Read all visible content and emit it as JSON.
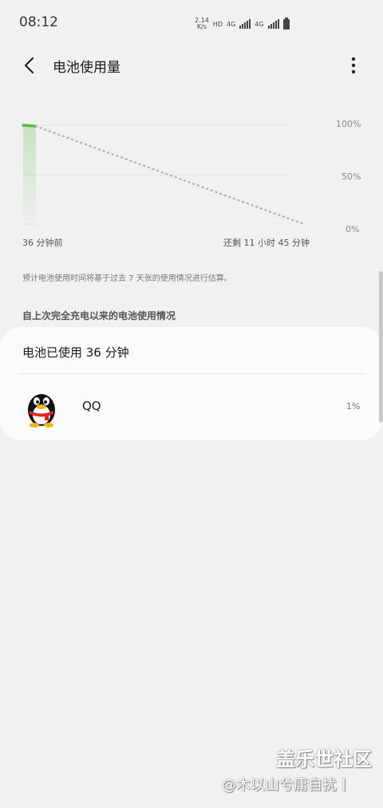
{
  "status_bar": {
    "time": "08:12",
    "net_speed_value": "2.14",
    "net_speed_unit": "K/s",
    "hd": "HD",
    "network_1": "4G",
    "network_2": "4G"
  },
  "header": {
    "title": "电池使用量"
  },
  "chart_data": {
    "type": "line",
    "y_ticks": [
      "100%",
      "50%",
      "0%"
    ],
    "ylim": [
      0,
      100
    ],
    "x_start_label": "36 分钟前",
    "x_end_label": "还剩 11 小时 45 分钟",
    "series": [
      {
        "values": [
          {
            "x": -36,
            "y": 100
          },
          {
            "x": 0,
            "y": 99
          }
        ]
      },
      {
        "values": [
          {
            "x": 0,
            "y": 99
          },
          {
            "x": 705,
            "y": 0
          }
        ]
      }
    ],
    "colors": {
      "actual": "#5bbd47",
      "projection": "#b5b5b5",
      "grid": "#e2e2e2"
    }
  },
  "estimate_note": "预计电池使用时间将基于过去 7 天张的使用情况进行估算。",
  "section_header": "自上次完全充电以来的电池使用情况",
  "usage_card": {
    "title": "电池已使用 36 分钟",
    "apps": [
      {
        "name": "QQ",
        "percent": "1%",
        "icon": "qq-penguin-icon"
      }
    ]
  },
  "watermark": {
    "title": "盖乐世社区",
    "sub": "@木以山兮庸自扰丨"
  }
}
